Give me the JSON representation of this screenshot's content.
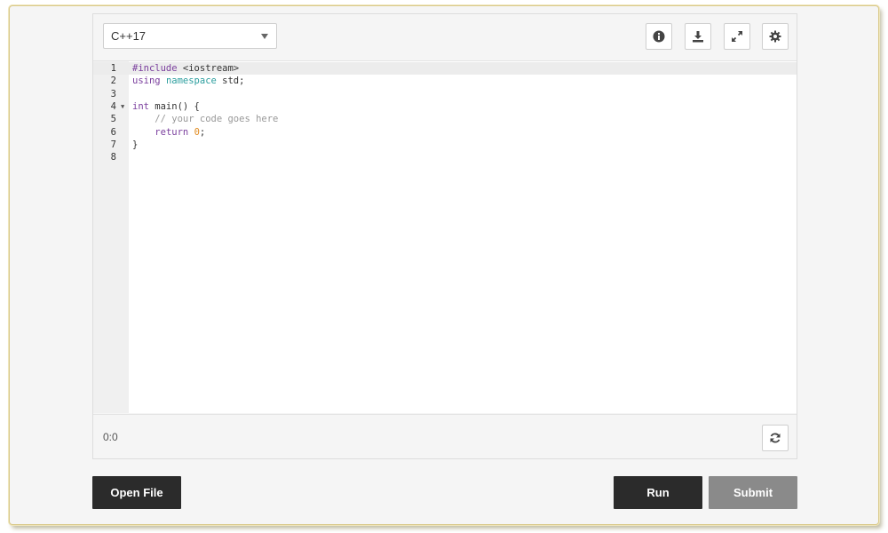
{
  "editor": {
    "language": "C++17",
    "cursor_position": "0:0",
    "lines": [
      {
        "n": "1",
        "tokens": [
          {
            "t": "#include ",
            "c": "kw"
          },
          {
            "t": "<iostream>",
            "c": ""
          }
        ]
      },
      {
        "n": "2",
        "tokens": [
          {
            "t": "using ",
            "c": "kw"
          },
          {
            "t": "namespace",
            "c": "kw2"
          },
          {
            "t": " std;",
            "c": ""
          }
        ]
      },
      {
        "n": "3",
        "tokens": []
      },
      {
        "n": "4",
        "fold": true,
        "tokens": [
          {
            "t": "int",
            "c": "kw"
          },
          {
            "t": " main() {",
            "c": ""
          }
        ]
      },
      {
        "n": "5",
        "tokens": [
          {
            "t": "    ",
            "c": ""
          },
          {
            "t": "// your code goes here",
            "c": "cm"
          }
        ]
      },
      {
        "n": "6",
        "tokens": [
          {
            "t": "    ",
            "c": ""
          },
          {
            "t": "return ",
            "c": "kw"
          },
          {
            "t": "0",
            "c": "num"
          },
          {
            "t": ";",
            "c": ""
          }
        ]
      },
      {
        "n": "7",
        "tokens": [
          {
            "t": "}",
            "c": ""
          }
        ]
      },
      {
        "n": "8",
        "tokens": []
      }
    ]
  },
  "toolbar": {
    "info_icon": "info-icon",
    "download_icon": "download-icon",
    "fullscreen_icon": "expand-icon",
    "settings_icon": "gear-icon",
    "refresh_icon": "refresh-icon"
  },
  "actions": {
    "open_file": "Open File",
    "run": "Run",
    "submit": "Submit"
  },
  "colors": {
    "dark_button": "#2b2b2b",
    "disabled_button": "#8a8a8a",
    "keyword": "#7a3e9d",
    "type_keyword": "#2a9d9d",
    "comment": "#999999",
    "number": "#e08a1e"
  }
}
